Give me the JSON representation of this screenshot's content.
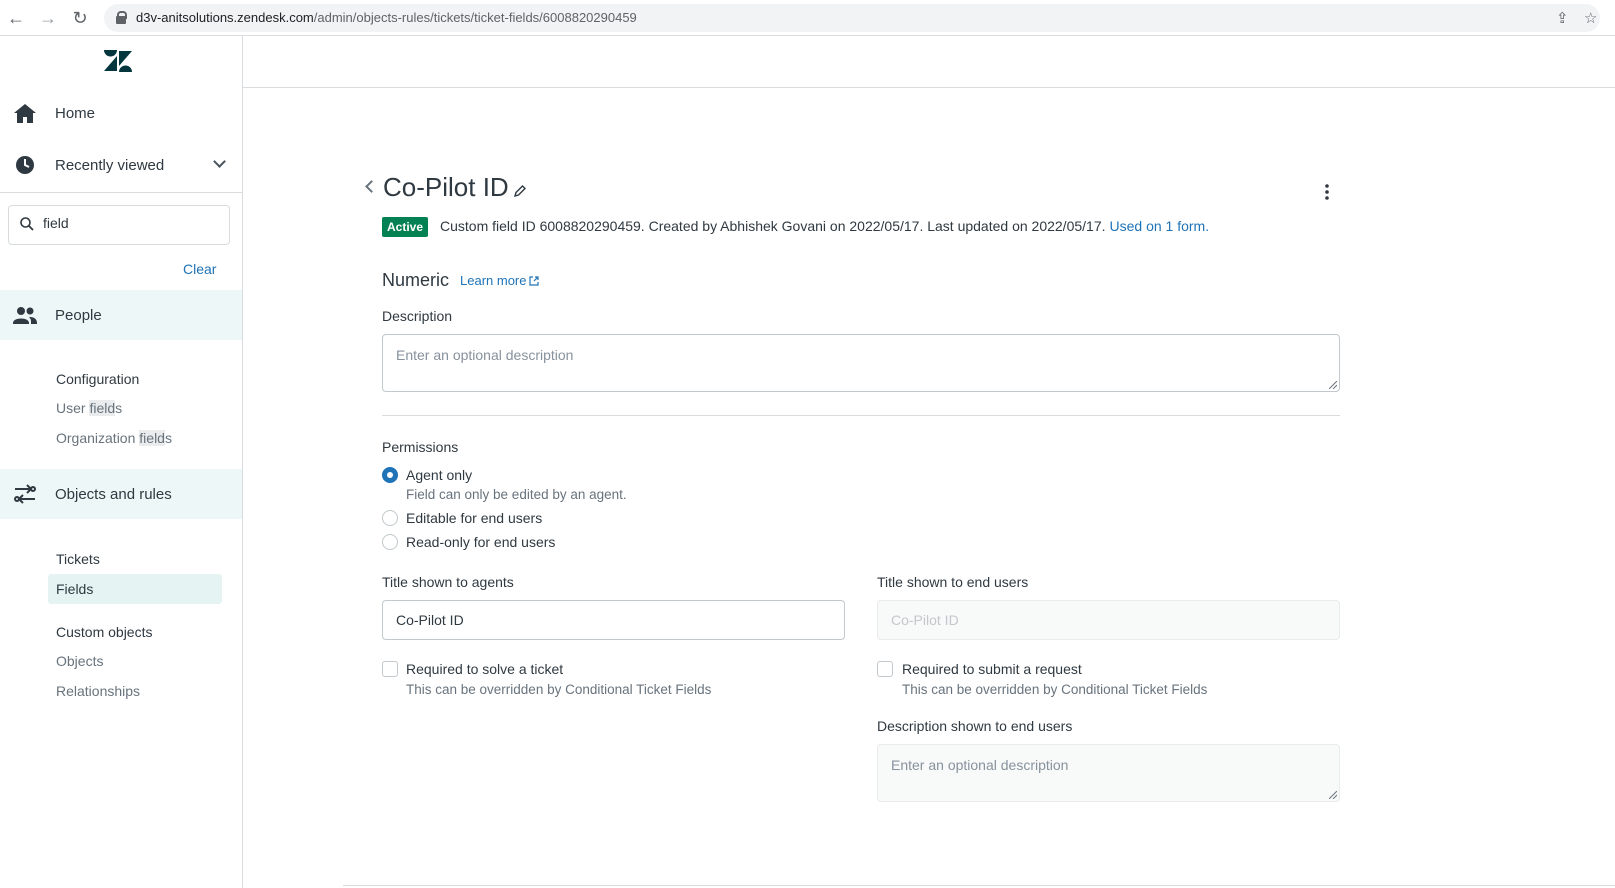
{
  "browser": {
    "url_domain": "d3v-anitsolutions.zendesk.com",
    "url_path": "/admin/objects-rules/tickets/ticket-fields/6008820290459"
  },
  "sidebar": {
    "home": "Home",
    "recently_viewed": "Recently viewed",
    "search_value": "field",
    "clear": "Clear",
    "people": "People",
    "people_group": {
      "heading": "Configuration",
      "user_fields_pre": "User ",
      "user_fields_hl": "field",
      "user_fields_post": "s",
      "org_fields_pre": "Organization ",
      "org_fields_hl": "field",
      "org_fields_post": "s"
    },
    "objects_rules": "Objects and rules",
    "tickets_group": {
      "heading": "Tickets",
      "fields": "Fields"
    },
    "custom_objects_group": {
      "heading": "Custom objects",
      "objects": "Objects",
      "relationships": "Relationships"
    }
  },
  "header": {
    "title": "Co-Pilot ID",
    "status": "Active",
    "meta": "Custom field ID 6008820290459. Created by Abhishek Govani on 2022/05/17. Last updated on 2022/05/17.",
    "used_on": "Used on 1 form."
  },
  "field_type": {
    "name": "Numeric",
    "learn_more": "Learn more"
  },
  "description": {
    "label": "Description",
    "placeholder": "Enter an optional description"
  },
  "permissions": {
    "label": "Permissions",
    "options": [
      {
        "label": "Agent only",
        "hint": "Field can only be edited by an agent.",
        "selected": true
      },
      {
        "label": "Editable for end users",
        "selected": false
      },
      {
        "label": "Read-only for end users",
        "selected": false
      }
    ]
  },
  "agents": {
    "title_label": "Title shown to agents",
    "title_value": "Co-Pilot ID",
    "required_label": "Required to solve a ticket",
    "required_hint": "This can be overridden by Conditional Ticket Fields"
  },
  "end_users": {
    "title_label": "Title shown to end users",
    "title_placeholder": "Co-Pilot ID",
    "required_label": "Required to submit a request",
    "required_hint": "This can be overridden by Conditional Ticket Fields",
    "description_label": "Description shown to end users",
    "description_placeholder": "Enter an optional description"
  },
  "colors": {
    "accent": "#1f73b7",
    "active_badge": "#038153",
    "sidebar_active": "#edf7f7"
  }
}
